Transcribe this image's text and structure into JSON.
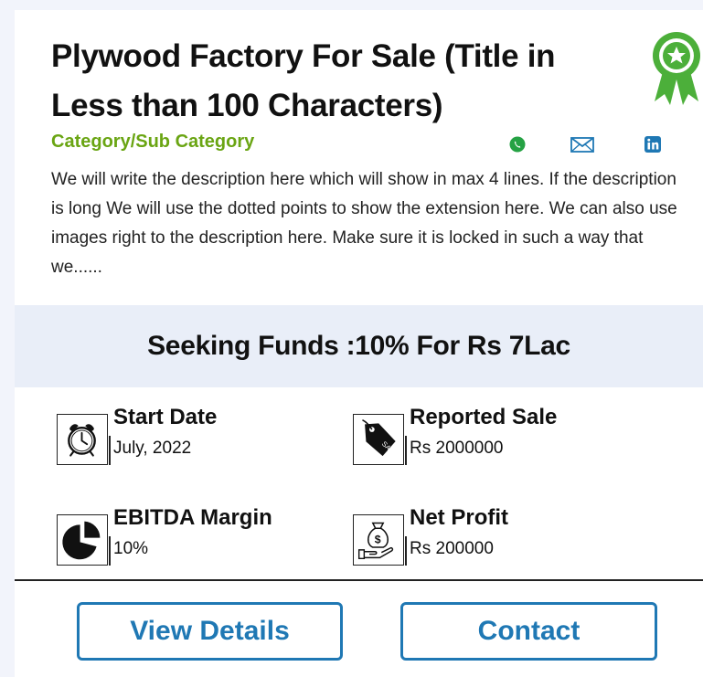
{
  "listing": {
    "title": "Plywood Factory For Sale (Title in Less than 100 Characters)",
    "category": "Category/Sub Category",
    "description": "We will write the description here which will show in max 4 lines. If the description is long We will use the dotted points to show the extension here. We can also use images right to the description here. Make sure it is locked in such a way that we......"
  },
  "share": {
    "icons": [
      "whatsapp-icon",
      "email-icon",
      "linkedin-icon"
    ]
  },
  "funding": {
    "text": "Seeking Funds :10% For Rs 7Lac"
  },
  "stats": {
    "start_date": {
      "label": "Start Date",
      "value": "July, 2022",
      "icon": "alarm-clock-icon"
    },
    "reported_sale": {
      "label": "Reported Sale",
      "value": "Rs 2000000",
      "icon": "sale-tag-icon"
    },
    "ebitda": {
      "label": "EBITDA Margin",
      "value": "10%",
      "icon": "pie-chart-icon"
    },
    "net_profit": {
      "label": "Net Profit",
      "value": "Rs 200000",
      "icon": "money-bag-hand-icon"
    }
  },
  "actions": {
    "view_details": "View Details",
    "contact": "Contact"
  },
  "colors": {
    "category": "#6aa513",
    "badge": "#4caf3a",
    "button": "#1f78b4",
    "funds_bg": "#e9eef8",
    "whatsapp": "#25a244",
    "email": "#1f78b4",
    "linkedin": "#1f78b4"
  }
}
